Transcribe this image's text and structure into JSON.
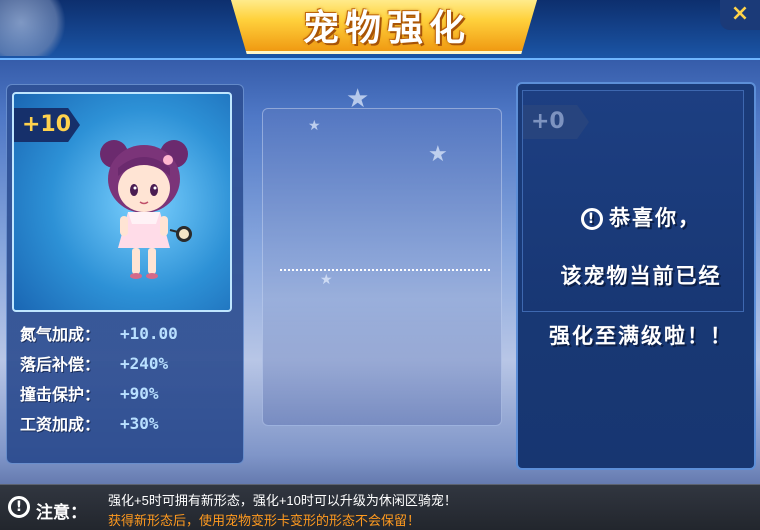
{
  "title": "宠物强化",
  "close_label": "×",
  "left_pet": {
    "level": "+10",
    "stats": [
      {
        "label": "氮气加成：",
        "value": "+10.00"
      },
      {
        "label": "落后补偿：",
        "value": "+240%"
      },
      {
        "label": "撞击保护：",
        "value": "+90%"
      },
      {
        "label": "工资加成：",
        "value": "+30%"
      }
    ]
  },
  "right_pet": {
    "level": "+0",
    "notice_icon": "!",
    "notice_line1": "恭喜你，",
    "notice_line2": "该宠物当前已经",
    "notice_line3": "强化至满级啦！！"
  },
  "tips": {
    "icon": "!",
    "label": "注意：",
    "line1": "强化+5时可拥有新形态，强化+10时可以升级为休闲区骑宠！",
    "line2": "获得新形态后，使用宠物变形卡变形的形态不会保留！"
  },
  "colors": {
    "title_gold": "#ffd23d",
    "stat_value": "#b9e0ff",
    "warning_orange": "#ff9a1f"
  }
}
